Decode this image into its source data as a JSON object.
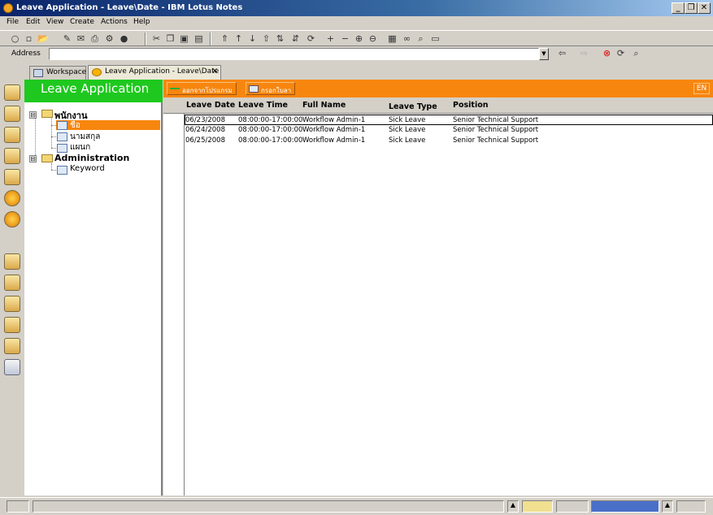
{
  "window": {
    "title": "Leave Application - Leave\\Date - IBM Lotus Notes",
    "buttons": {
      "minimize": "_",
      "maximize": "❐",
      "close": "✕"
    }
  },
  "menu": [
    "File",
    "Edit",
    "View",
    "Create",
    "Actions",
    "Help"
  ],
  "address": {
    "label": "Address",
    "value": ""
  },
  "tabs": [
    {
      "label": "Workspace",
      "icon": "workspace-icon"
    },
    {
      "label": "Leave Application - Leave\\Date",
      "icon": "database-icon",
      "close": "✕"
    }
  ],
  "nav": {
    "title": "Leave Application",
    "tree": [
      {
        "label": "พนักงาน",
        "expander": "⊟",
        "level": 0
      },
      {
        "label": "ชื่อ",
        "level": 1,
        "selected": true
      },
      {
        "label": "นามสกุล",
        "level": 1
      },
      {
        "label": "แผนก",
        "level": 1
      },
      {
        "label": "Administration",
        "expander": "⊟",
        "level": 0
      },
      {
        "label": "Keyword",
        "level": 1
      }
    ]
  },
  "actions": {
    "buttons": [
      {
        "label": "ออกจากโปรแกรม",
        "icon": "exit-arrow-icon"
      },
      {
        "label": "กรอกใบลา",
        "icon": "form-icon"
      }
    ],
    "lang": "EN"
  },
  "view": {
    "columns": [
      "Leave Date",
      "Leave Time",
      "Full Name",
      "Leave Type",
      "Position"
    ],
    "rows": [
      [
        "06/23/2008",
        "08:00:00-17:00:00",
        "Workflow Admin-1",
        "Sick Leave",
        "Senior Technical Support"
      ],
      [
        "06/24/2008",
        "08:00:00-17:00:00",
        "Workflow Admin-1",
        "Sick Leave",
        "Senior Technical Support"
      ],
      [
        "06/25/2008",
        "08:00:00-17:00:00",
        "Workflow Admin-1",
        "Sick Leave",
        "Senior Technical Support"
      ]
    ]
  },
  "colors": {
    "nav_title": "#1ec81e",
    "action_bar": "#f7860f",
    "selection": "#f7860f"
  }
}
